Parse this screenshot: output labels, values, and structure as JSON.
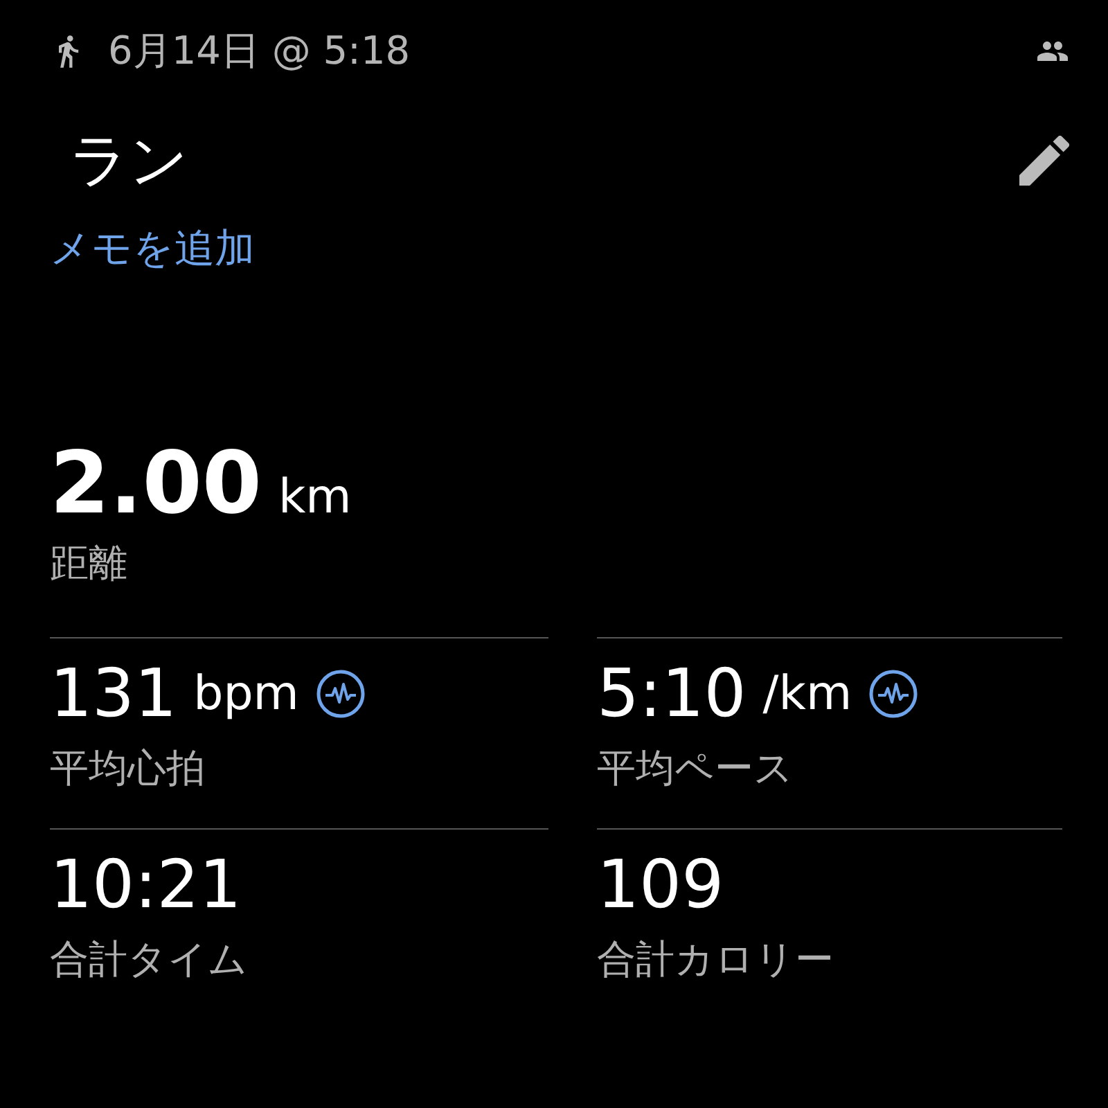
{
  "header": {
    "date": "6月14日 @ 5:18"
  },
  "activity": {
    "title": "ラン",
    "memo_link": "メモを追加"
  },
  "distance": {
    "value": "2.00",
    "unit": "km",
    "label": "距離"
  },
  "metrics": [
    {
      "value": "131",
      "unit": "bpm",
      "label": "平均心拍",
      "has_chart": true
    },
    {
      "value": "5:10",
      "unit": "/km",
      "label": "平均ペース",
      "has_chart": true
    },
    {
      "value": "10:21",
      "label": "合計タイム",
      "has_chart": false
    },
    {
      "value": "109",
      "label": "合計カロリー",
      "has_chart": false
    }
  ]
}
